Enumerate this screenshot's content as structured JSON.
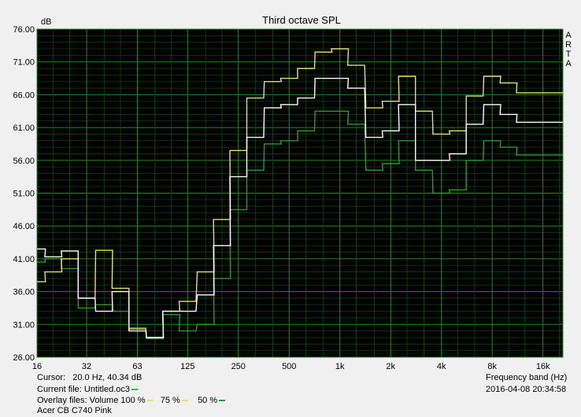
{
  "chart_data": {
    "type": "line",
    "title": "Third octave SPL",
    "ylabel": "dB",
    "xlabel": "Frequency band (Hz)",
    "y_ticks": [
      "76.00",
      "71.00",
      "66.00",
      "61.00",
      "56.00",
      "51.00",
      "46.00",
      "41.00",
      "36.00",
      "31.00",
      "26.00"
    ],
    "ylim": [
      26,
      76
    ],
    "x_ticks": [
      "16",
      "32",
      "63",
      "125",
      "250",
      "500",
      "1k",
      "2k",
      "4k",
      "8k",
      "16k"
    ],
    "xlim_hz": [
      16,
      21000
    ],
    "x_scale": "log",
    "bands_hz": [
      16,
      20,
      25,
      31.5,
      40,
      50,
      63,
      80,
      100,
      125,
      160,
      200,
      250,
      315,
      400,
      500,
      630,
      800,
      1000,
      1250,
      1600,
      2000,
      2500,
      3150,
      4000,
      5000,
      6300,
      8000,
      10000,
      12500,
      16000,
      20000
    ],
    "series": [
      {
        "name": "Untitled.oc3",
        "color": "#ffffff",
        "values": [
          42.5,
          41.3,
          42.2,
          35.0,
          33.0,
          36.0,
          30.0,
          29.0,
          33.0,
          33.0,
          35.5,
          43.0,
          53.5,
          59.5,
          64.0,
          64.5,
          65.5,
          68.5,
          68.5,
          67.0,
          59.5,
          60.5,
          64.5,
          56.0,
          56.0,
          57.0,
          61.5,
          64.5,
          63.0,
          61.8,
          61.8,
          61.8
        ]
      },
      {
        "name": "75 %",
        "color": "#e3e36b",
        "values": [
          37.5,
          39.0,
          41.0,
          35.0,
          42.3,
          36.5,
          30.3,
          29.0,
          33.0,
          34.5,
          39.0,
          47.0,
          57.5,
          65.5,
          68.0,
          68.5,
          70.0,
          72.5,
          73.0,
          70.5,
          64.0,
          65.0,
          68.8,
          63.5,
          60.0,
          60.5,
          65.8,
          68.8,
          67.8,
          66.3,
          66.3,
          66.3
        ]
      },
      {
        "name": "50 %",
        "color": "#2e9a2e",
        "values": [
          40.5,
          41.0,
          39.5,
          33.5,
          34.0,
          33.0,
          30.5,
          28.8,
          32.5,
          30.0,
          31.0,
          38.0,
          48.5,
          54.5,
          58.5,
          59.0,
          60.5,
          63.5,
          63.5,
          61.5,
          54.5,
          55.5,
          59.0,
          54.5,
          51.0,
          51.5,
          56.0,
          59.0,
          58.0,
          56.8,
          56.8,
          56.8
        ]
      }
    ],
    "arta_label": [
      "A",
      "R",
      "T",
      "A"
    ],
    "grid": true
  },
  "info": {
    "cursor_label": "Cursor:",
    "cursor_value": "20.0 Hz, 40.34 dB",
    "current_file_label": "Current file:",
    "current_file_value": "Untitled.oc3",
    "overlay_label": "Overlay files: Volume 100 %",
    "overlay_75": "75 %",
    "overlay_50": "50 %",
    "device": "Acer CB C740 Pink",
    "timestamp": "2016-04-08  20:34:58",
    "colors": {
      "current": "#00d000",
      "yellow": "#e3e36b",
      "green": "#2e9a2e"
    }
  }
}
